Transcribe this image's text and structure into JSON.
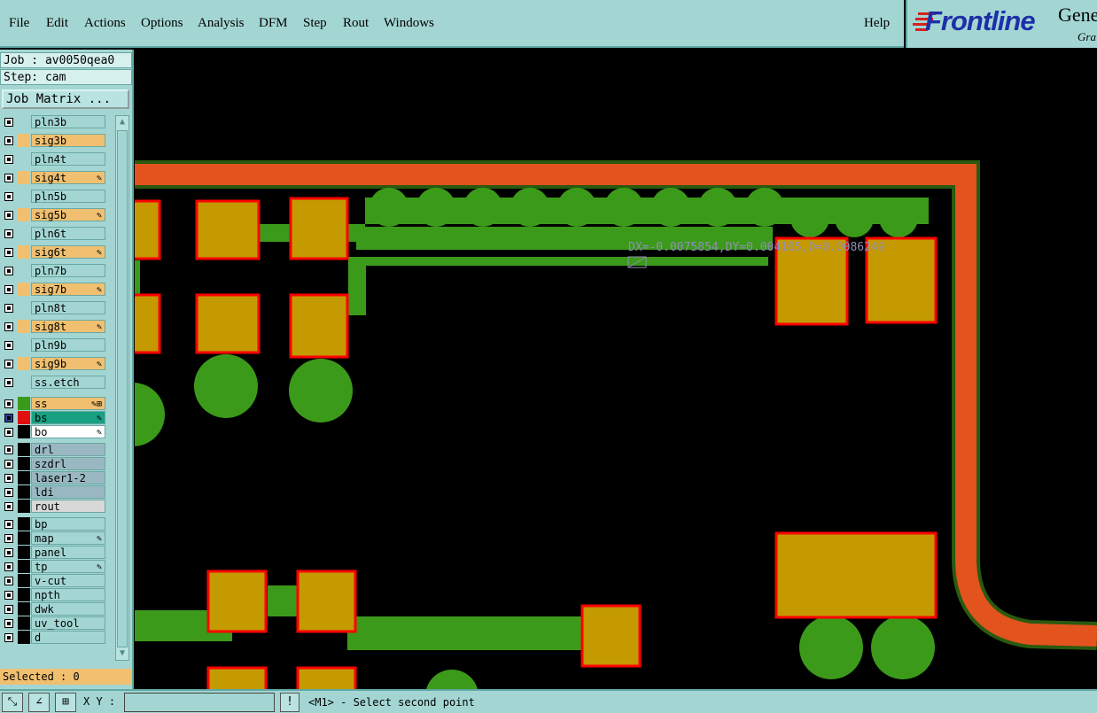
{
  "menubar": {
    "items": [
      "File",
      "Edit",
      "Actions",
      "Options",
      "Analysis",
      "DFM",
      "Step",
      "Rout",
      "Windows"
    ],
    "help": "Help"
  },
  "logo": {
    "brand": "Frontline",
    "product": "Gene",
    "subtitle": "Gra"
  },
  "job": {
    "label": "Job : av0050qea0",
    "step": "Step: cam",
    "matrix_button": "Job Matrix ..."
  },
  "layers": [
    {
      "name": "pln3b",
      "color": "#a3d6d3",
      "bg": "#a3d6d3",
      "flag": ""
    },
    {
      "name": "sig3b",
      "color": "#f0c070",
      "bg": "#f0c070",
      "flag": ""
    },
    {
      "name": "pln4t",
      "color": "#a3d6d3",
      "bg": "#a3d6d3",
      "flag": ""
    },
    {
      "name": "sig4t",
      "color": "#f0c070",
      "bg": "#f0c070",
      "flag": "✎"
    },
    {
      "name": "pln5b",
      "color": "#a3d6d3",
      "bg": "#a3d6d3",
      "flag": ""
    },
    {
      "name": "sig5b",
      "color": "#f0c070",
      "bg": "#f0c070",
      "flag": "✎"
    },
    {
      "name": "pln6t",
      "color": "#a3d6d3",
      "bg": "#a3d6d3",
      "flag": ""
    },
    {
      "name": "sig6t",
      "color": "#f0c070",
      "bg": "#f0c070",
      "flag": "✎"
    },
    {
      "name": "pln7b",
      "color": "#a3d6d3",
      "bg": "#a3d6d3",
      "flag": ""
    },
    {
      "name": "sig7b",
      "color": "#f0c070",
      "bg": "#f0c070",
      "flag": "✎"
    },
    {
      "name": "pln8t",
      "color": "#a3d6d3",
      "bg": "#a3d6d3",
      "flag": ""
    },
    {
      "name": "sig8t",
      "color": "#f0c070",
      "bg": "#f0c070",
      "flag": "✎"
    },
    {
      "name": "pln9b",
      "color": "#a3d6d3",
      "bg": "#a3d6d3",
      "flag": ""
    },
    {
      "name": "sig9b",
      "color": "#f0c070",
      "bg": "#f0c070",
      "flag": "✎"
    },
    {
      "name": "ss.etch",
      "color": "#a3d6d3",
      "bg": "#a3d6d3",
      "flag": ""
    },
    {
      "name": "ss",
      "color": "#3c9a1a",
      "bg": "#f0c070",
      "flag": "✎⊞"
    },
    {
      "name": "bs",
      "color": "#e01010",
      "bg": "#18a080",
      "flag": "✎"
    },
    {
      "name": "bo",
      "color": "#000000",
      "bg": "#ffffff",
      "flag": "✎"
    },
    {
      "name": "drl",
      "color": "#000000",
      "bg": "#9ab8c2",
      "flag": ""
    },
    {
      "name": "szdrl",
      "color": "#000000",
      "bg": "#9ab8c2",
      "flag": ""
    },
    {
      "name": "laser1-2",
      "color": "#000000",
      "bg": "#9ab8c2",
      "flag": ""
    },
    {
      "name": "ldi",
      "color": "#000000",
      "bg": "#9ab8c2",
      "flag": ""
    },
    {
      "name": "rout",
      "color": "#000000",
      "bg": "#d8d8d8",
      "flag": ""
    },
    {
      "name": "bp",
      "color": "#000000",
      "bg": "#a3d6d3",
      "flag": ""
    },
    {
      "name": "map",
      "color": "#000000",
      "bg": "#a3d6d3",
      "flag": "✎"
    },
    {
      "name": "panel",
      "color": "#000000",
      "bg": "#a3d6d3",
      "flag": ""
    },
    {
      "name": "tp",
      "color": "#000000",
      "bg": "#a3d6d3",
      "flag": "✎"
    },
    {
      "name": "v-cut",
      "color": "#000000",
      "bg": "#a3d6d3",
      "flag": ""
    },
    {
      "name": "npth",
      "color": "#000000",
      "bg": "#a3d6d3",
      "flag": ""
    },
    {
      "name": "dwk",
      "color": "#000000",
      "bg": "#a3d6d3",
      "flag": ""
    },
    {
      "name": "uv_tool",
      "color": "#000000",
      "bg": "#a3d6d3",
      "flag": ""
    },
    {
      "name": "d",
      "color": "#000000",
      "bg": "#a3d6d3",
      "flag": ""
    }
  ],
  "selected": "Selected : 0",
  "status": {
    "xy_label": "X Y :",
    "prompt": "<M1> - Select second point",
    "alert_icon": "!"
  },
  "measurement": "DX=-0.0075854,DY=0.004105,D=0.0086249",
  "colors": {
    "copper": "#c49a00",
    "pad_outline": "#ff0000",
    "signal": "#3c9a1a",
    "route": "#e2531e",
    "ui_bg": "#a3d6d3"
  }
}
